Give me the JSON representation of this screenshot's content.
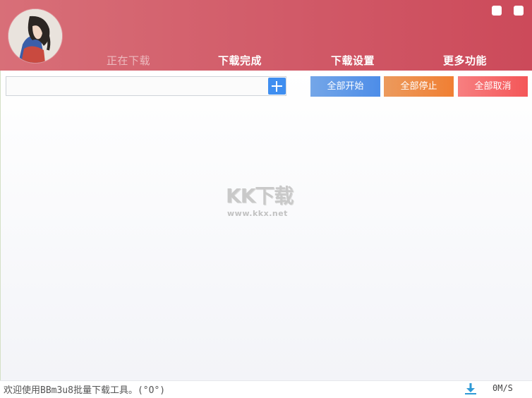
{
  "tabs": [
    {
      "label": "正在下载",
      "active": true
    },
    {
      "label": "下载完成",
      "active": false
    },
    {
      "label": "下载设置",
      "active": false
    },
    {
      "label": "更多功能",
      "active": false
    }
  ],
  "url_input": {
    "value": "",
    "placeholder": ""
  },
  "actions": {
    "start_all": "全部开始",
    "stop_all": "全部停止",
    "cancel_all": "全部取消"
  },
  "watermark": {
    "main": "KK下载",
    "sub": "www.kkx.net"
  },
  "status": {
    "message": "欢迎使用BBm3u8批量下载工具。(°O°)",
    "speed": "0M/S"
  },
  "colors": {
    "header_start": "#d86f78",
    "header_end": "#cc4a5a",
    "start_btn": "#4d8de8",
    "stop_btn": "#f07f33",
    "cancel_btn": "#f45658",
    "download_icon": "#2f9ad6"
  },
  "icons": {
    "add": "plus-icon",
    "download": "download-arrow-icon",
    "minimize": "minimize-icon",
    "close": "close-icon"
  }
}
